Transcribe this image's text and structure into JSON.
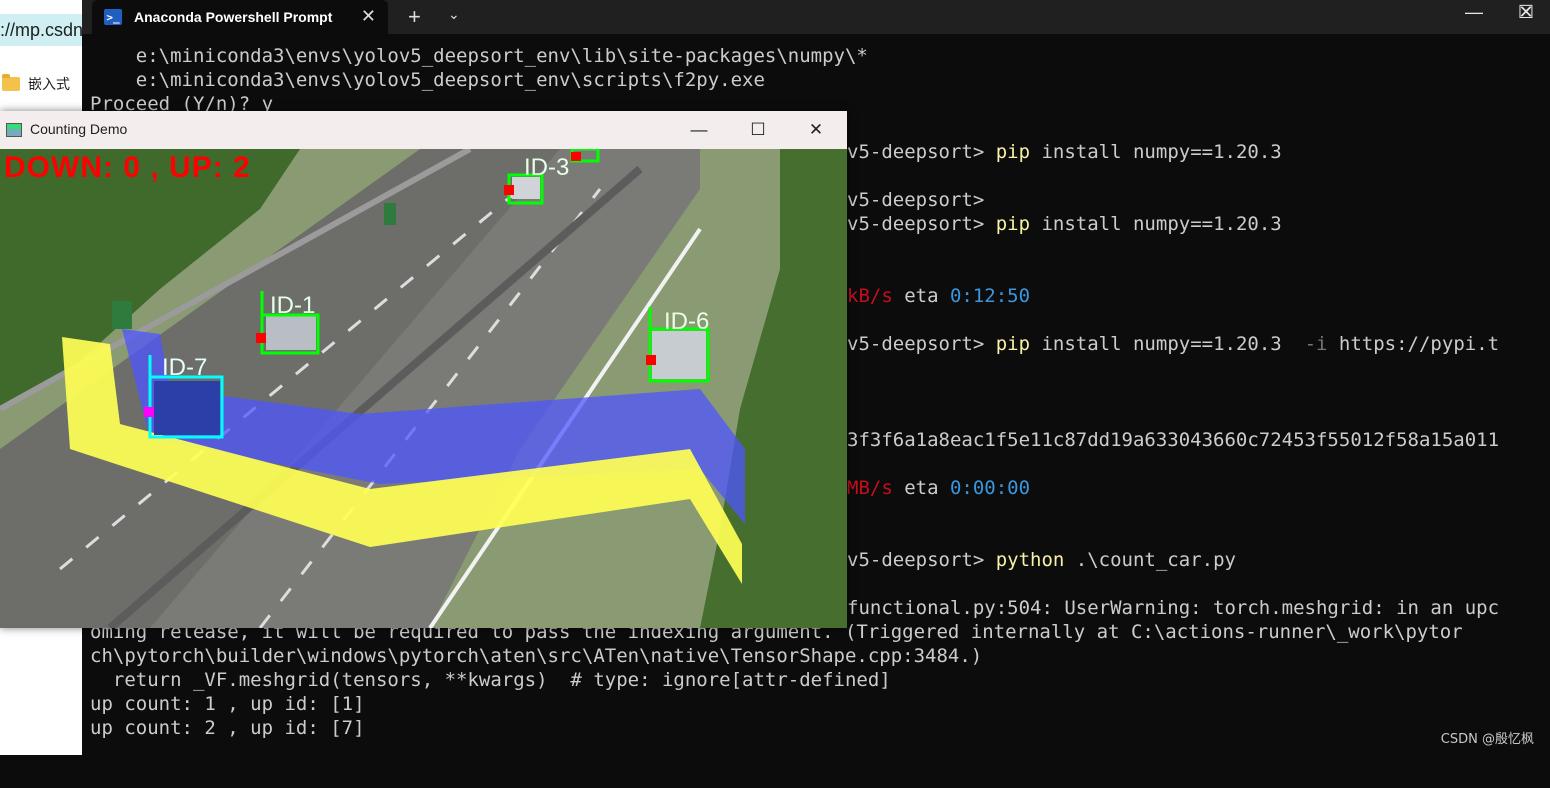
{
  "browser": {
    "url_fragment": "://mp.csdn",
    "bookmark_label": "嵌入式"
  },
  "terminal": {
    "tab_title": "Anaconda Powershell Prompt",
    "tab_close": "✕",
    "new_tab": "+",
    "dropdown": "⌄",
    "window_controls": {
      "minimize": "—",
      "maximize": "☐",
      "close": "✕"
    },
    "lines": [
      "    e:\\miniconda3\\envs\\yolov5_deepsort_env\\lib\\site-packages\\numpy\\*",
      "    e:\\miniconda3\\envs\\yolov5_deepsort_env\\scripts\\f2py.exe",
      "Proceed (Y/n)? y"
    ],
    "right": {
      "prompt1": "v5-deepsort> ",
      "cmd1_pip": "pip",
      "cmd1_rest": " install numpy==1.20.3",
      "prompt2": "v5-deepsort>",
      "prompt3": "v5-deepsort> ",
      "cmd3_pip": "pip",
      "cmd3_rest": " install numpy==1.20.3",
      "speed1": "kB/s",
      "eta1_label": " eta ",
      "eta1": "0:12:50",
      "prompt4": "v5-deepsort> ",
      "cmd4_pip": "pip",
      "cmd4_rest": " install numpy==1.20.3",
      "cmd4_flag": "  -i",
      "cmd4_url": " https://pypi.t",
      "hash": "3f3f6a1a8eac1f5e11c87dd19a633043660c72453f55012f58a15a011",
      "speed2": "MB/s",
      "eta2_label": " eta ",
      "eta2": "0:00:00",
      "prompt5": "v5-deepsort> ",
      "cmd5_python": "python",
      "cmd5_rest": " .\\count_car.py",
      "warn1": "functional.py:504: UserWarning: torch.meshgrid: in an upc"
    },
    "bottom_lines": [
      "oming release, it will be required to pass the indexing argument. (Triggered internally at C:\\actions-runner\\_work\\pytor",
      "ch\\pytorch\\builder\\windows\\pytorch\\aten\\src\\ATen\\native\\TensorShape.cpp:3484.)",
      "  return _VF.meshgrid(tensors, **kwargs)  # type: ignore[attr-defined]",
      "up count: 1 , up id: [1]",
      "up count: 2 , up id: [7]"
    ]
  },
  "demo": {
    "title": "Counting Demo",
    "controls": {
      "minimize": "—",
      "maximize": "☐",
      "close": "✕"
    },
    "counter": "DOWN: 0 , UP: 2",
    "tracks": [
      "ID-1",
      "ID-3",
      "ID-6",
      "ID-7"
    ]
  },
  "watermark": "CSDN @殷忆枫"
}
